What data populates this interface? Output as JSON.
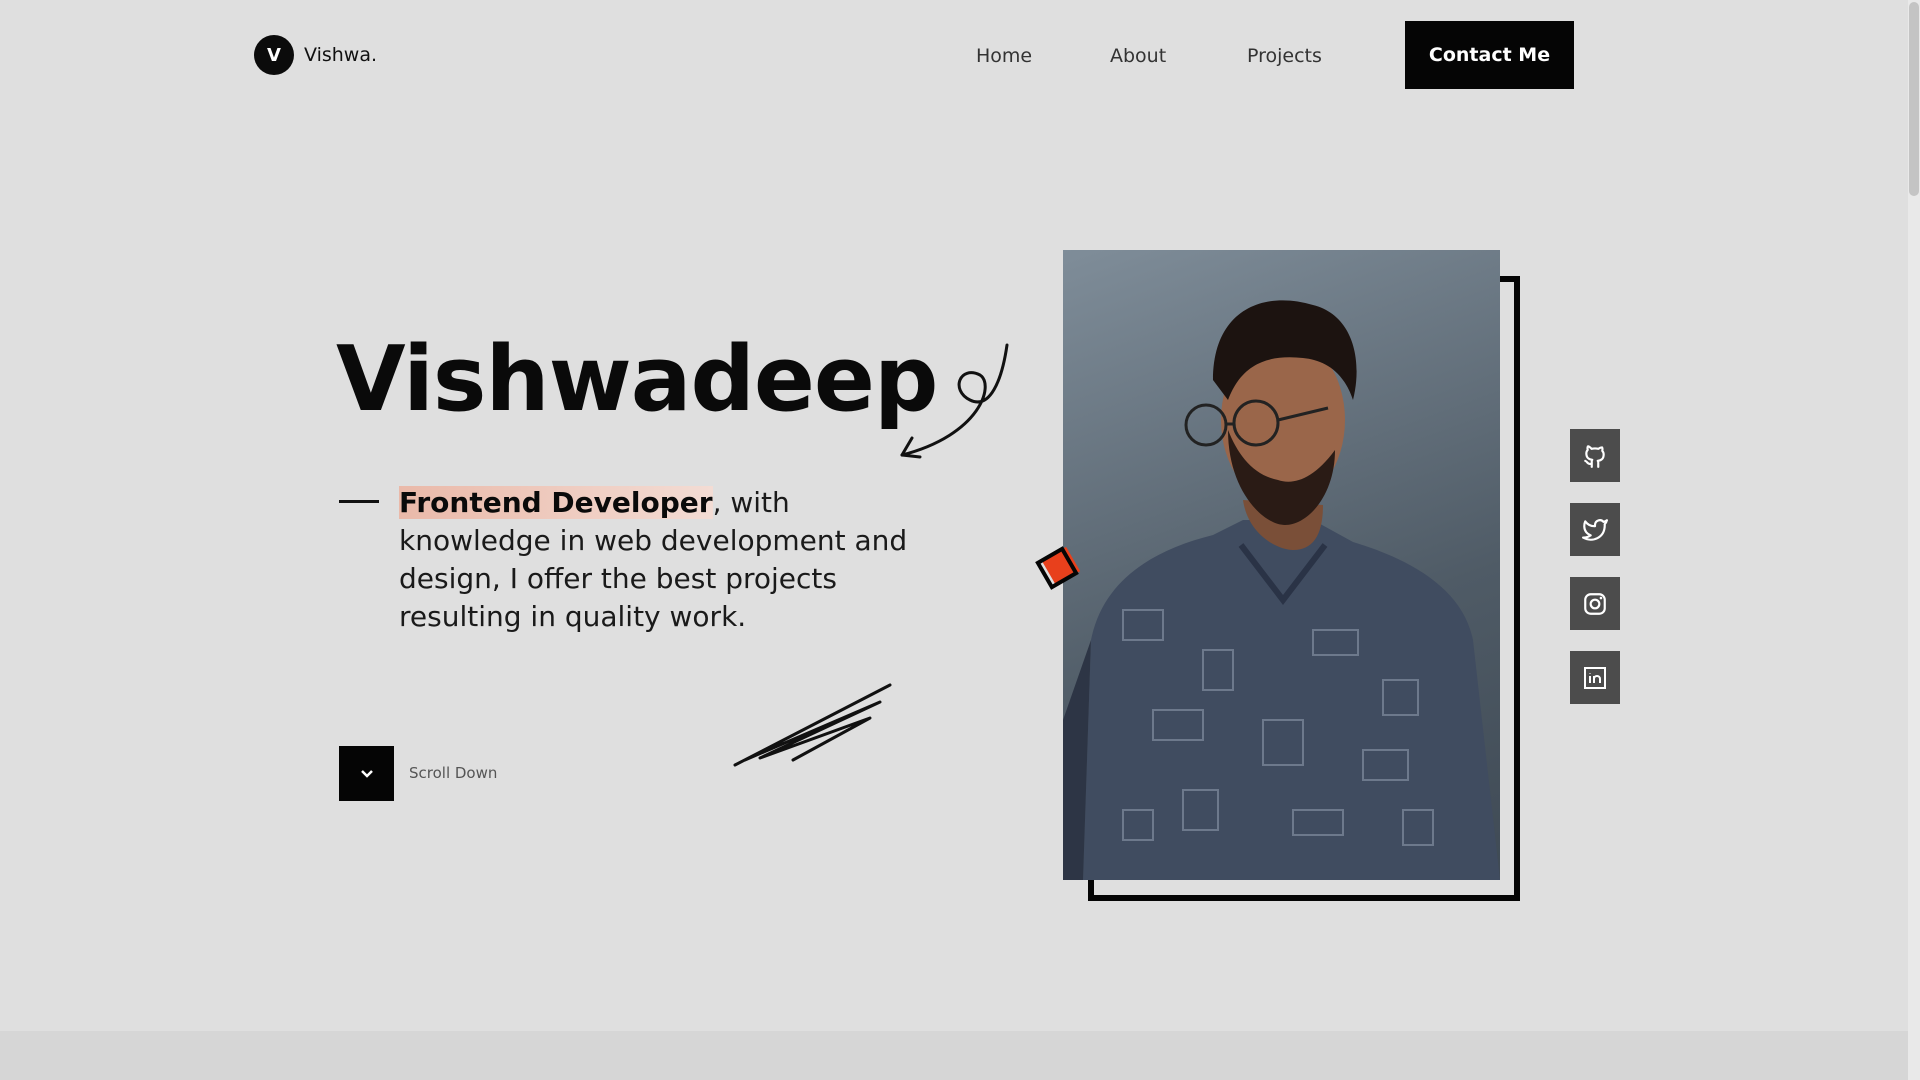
{
  "logo": {
    "mark": "V",
    "text": "Vishwa."
  },
  "nav": {
    "home": "Home",
    "about": "About",
    "projects": "Projects",
    "contact": "Contact Me"
  },
  "hero": {
    "name": "Vishwadeep",
    "role": "Frontend Developer",
    "description": ", with knowledge in web development and design, I offer the best projects resulting in quality work.",
    "scroll_label": "Scroll Down"
  },
  "socials": [
    "github-icon",
    "twitter-icon",
    "instagram-icon",
    "linkedin-icon"
  ],
  "colors": {
    "background": "#dfdfdf",
    "dark": "#050505",
    "accent": "#e8401c",
    "highlight": "#eab9a9"
  }
}
